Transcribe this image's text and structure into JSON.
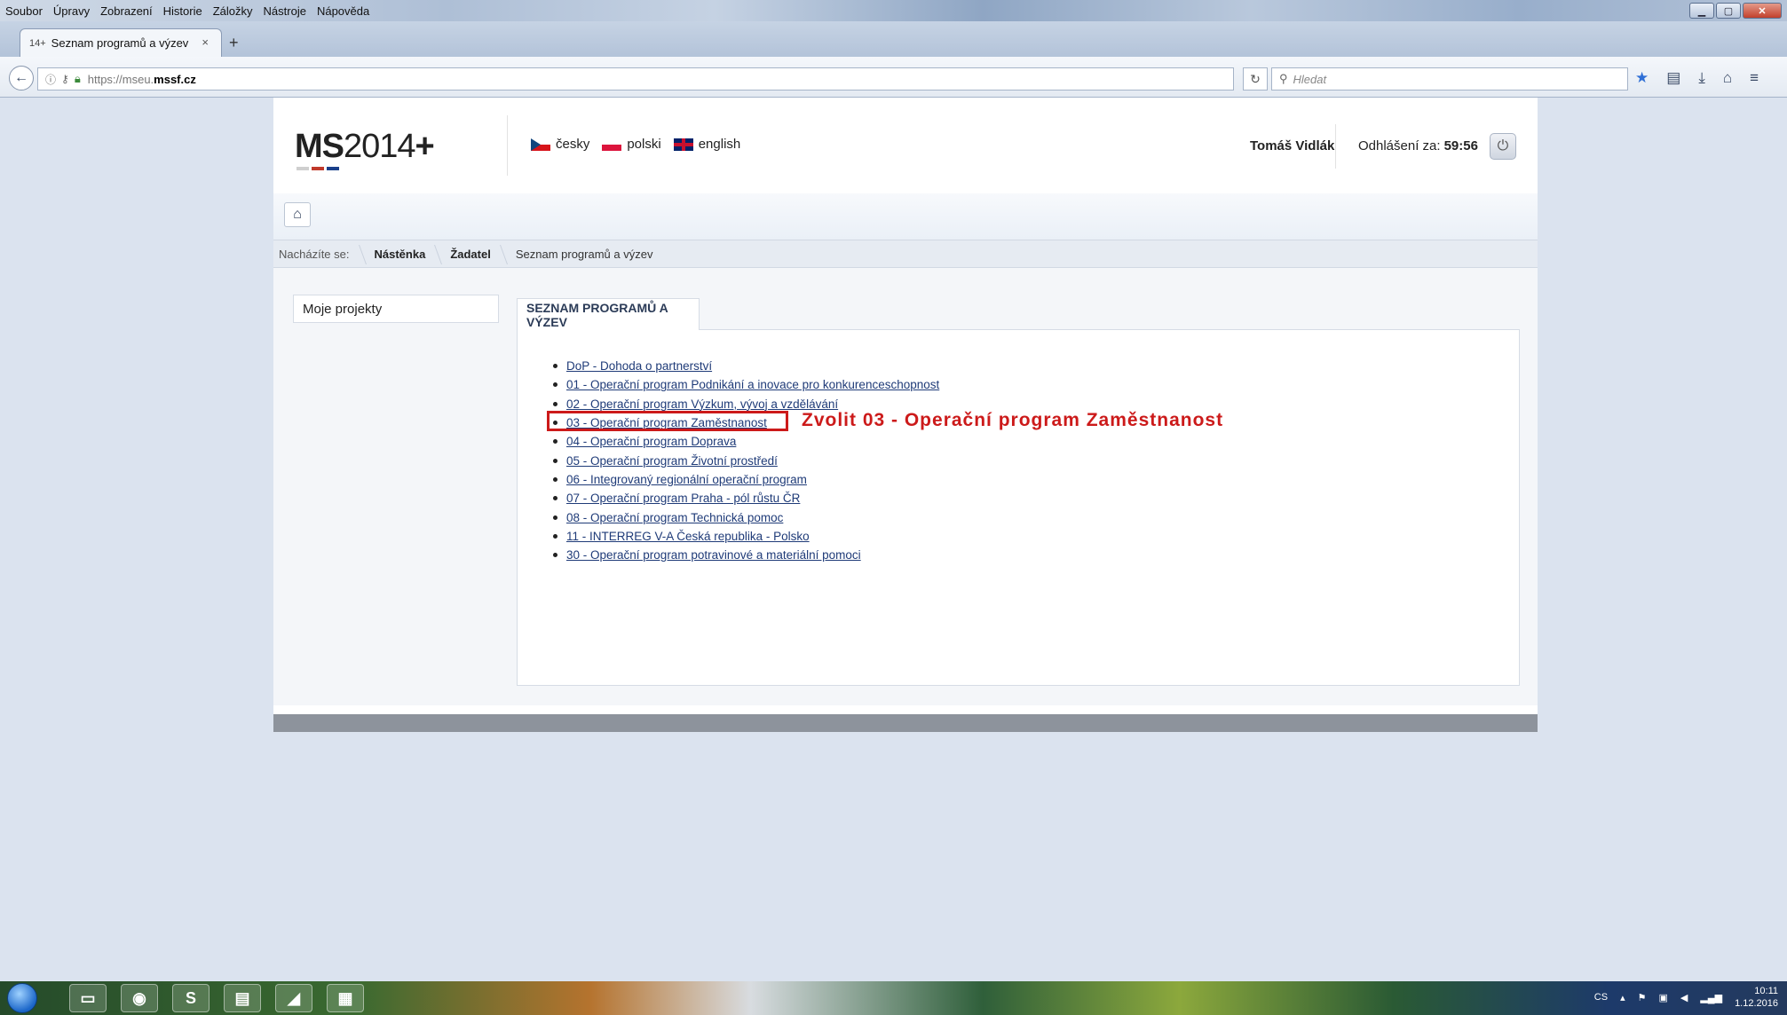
{
  "browser": {
    "menu": [
      "Soubor",
      "Úpravy",
      "Zobrazení",
      "Historie",
      "Záložky",
      "Nástroje",
      "Nápověda"
    ],
    "tab_title": "Seznam programů a výzev",
    "tab_close": "×",
    "new_tab": "+",
    "url_scheme": "https://mseu.",
    "url_host": "mssf.cz",
    "search_placeholder": "Hledat"
  },
  "header": {
    "logo_ms": "MS",
    "logo_year": "2014",
    "logo_plus": "+",
    "logo_colors": [
      "#cfcfcf",
      "#c0392b",
      "#1a3f8a"
    ],
    "languages": [
      {
        "label": "česky"
      },
      {
        "label": "polski"
      },
      {
        "label": "english"
      }
    ],
    "user_name": "Tomáš Vidlák",
    "logout_label": "Odhlášení za:",
    "logout_timer": "59:56"
  },
  "breadcrumb": {
    "label": "Nacházíte se:",
    "items": [
      "Nástěnka",
      "Žadatel",
      "Seznam programů a výzev"
    ]
  },
  "sidebar": {
    "item": "Moje projekty"
  },
  "panel": {
    "title": "SEZNAM PROGRAMŮ A VÝZEV",
    "programs": [
      "DoP - Dohoda o partnerství",
      "01 - Operační program Podnikání a inovace pro konkurenceschopnost",
      "02 - Operační program Výzkum, vývoj a vzdělávání",
      "03 - Operační program Zaměstnanost",
      "04 - Operační program Doprava",
      "05 - Operační program Životní prostředí",
      "06 - Integrovaný regionální operační program",
      "07 - Operační program Praha - pól růstu ČR",
      "08 - Operační program Technická pomoc",
      "11 - INTERREG V-A Česká republika - Polsko",
      "30 - Operační program potravinové a materiální pomoci"
    ],
    "annotation": "Zvolit 03 - Operační program Zaměstnanost"
  },
  "taskbar": {
    "apps": [
      "",
      "",
      "S",
      "",
      "",
      ""
    ],
    "lang": "CS",
    "time": "10:11",
    "date": "1.12.2016"
  },
  "colors": {
    "link": "#1f3b78",
    "annotation": "#cc1a1a"
  }
}
